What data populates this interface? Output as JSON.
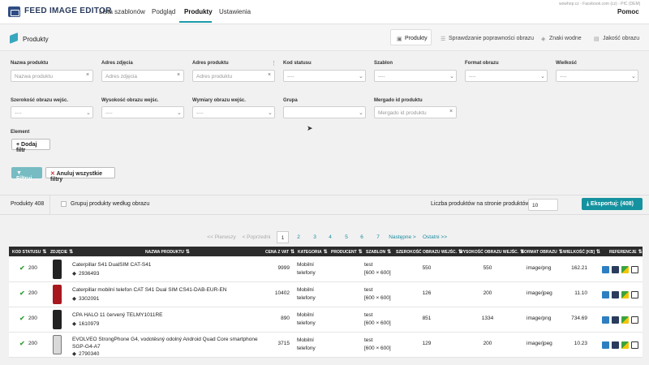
{
  "app": {
    "title": "FEED IMAGE EDITOR",
    "nav": [
      "Lista szablonów",
      "Podgląd",
      "Produkty",
      "Ustawienia"
    ],
    "active_nav": 2,
    "tiny_text": "wowhop.cz - Facebook.com (cz) - PIC (DEM)",
    "help": "Pomoc"
  },
  "sub": {
    "title": "Produkty",
    "tabs": [
      "Produkty",
      "Sprawdzanie poprawności obrazu",
      "Znaki wodne",
      "Jakość obrazu"
    ]
  },
  "filters": {
    "nazwa": {
      "label": "Nazwa produktu",
      "placeholder": "Nazwa produktu"
    },
    "adres_zdjecia": {
      "label": "Adres zdjęcia",
      "placeholder": "Adres zdjęcia"
    },
    "adres_produktu": {
      "label": "Adres produktu",
      "placeholder": "Adres produktu"
    },
    "kod_statusu": {
      "label": "Kod statusu",
      "placeholder": "----"
    },
    "szablon": {
      "label": "Szablon",
      "placeholder": "----"
    },
    "format": {
      "label": "Format obrazu",
      "placeholder": "----"
    },
    "wielkosc": {
      "label": "Wielkość",
      "placeholder": "----"
    },
    "szerokosc": {
      "label": "Szerokość obrazu wejśc.",
      "placeholder": "----"
    },
    "wysokosc": {
      "label": "Wysokość obrazu wejśc.",
      "placeholder": "----"
    },
    "wymiary": {
      "label": "Wymiary obrazu wejśc.",
      "placeholder": "----"
    },
    "grupa": {
      "label": "Grupa",
      "placeholder": ""
    },
    "mergado": {
      "label": "Mergado id produktu",
      "placeholder": "Mergado id produktu"
    },
    "element_label": "Element",
    "add_filter": "Dodaj filtr",
    "filter_btn": "Filtruj",
    "cancel_btn": "Anuluj wszystkie filtry"
  },
  "summary": {
    "count": "Produkty 408",
    "group_label": "Grupuj produkty według obrazu",
    "per_page_label": "Liczba produktów na stronie produktów:",
    "per_page": "10",
    "export": "Eksportuj: (408)"
  },
  "pagination": {
    "first": "<< Pierwszy",
    "prev": "< Poprzedni",
    "pages": [
      "1",
      "2",
      "3",
      "4",
      "5",
      "6",
      "7"
    ],
    "current": "1",
    "next": "Następne >",
    "last": "Ostatni >>"
  },
  "table": {
    "headers": [
      "KOD STATUSU",
      "ZDJĘCIE",
      "NAZWA PRODUKTU",
      "CENA Z VAT",
      "KATEGORIA",
      "PRODUCENT",
      "SZABLON",
      "SZEROKOŚĆ OBRAZU WEJŚC.",
      "WYSOKOŚĆ OBRAZU WEJŚC.",
      "FORMAT OBRAZU",
      "WIELKOŚĆ [KB]",
      "REFERENCJE"
    ],
    "rows": [
      {
        "status": "200",
        "name": "Caterpillar S41 DualSIM CAT-S41",
        "id": "2936493",
        "price": "9999",
        "cat1": "Mobilní",
        "cat2": "telefony",
        "tpl1": "test",
        "tpl2": "[600 × 600]",
        "w": "550",
        "h": "550",
        "fmt": "image/png",
        "size": "162.21",
        "img": "black"
      },
      {
        "status": "200",
        "name": "Caterpillar mobilní telefon CAT S41 Dual SIM CS41-DAB-EUR-EN",
        "id": "3302091",
        "price": "10402",
        "cat1": "Mobilní",
        "cat2": "telefony",
        "tpl1": "test",
        "tpl2": "[600 × 600]",
        "w": "126",
        "h": "200",
        "fmt": "image/jpeg",
        "size": "11.10",
        "img": "red"
      },
      {
        "status": "200",
        "name": "CPA HALO 11 červený TELMY1011RE",
        "id": "1610979",
        "price": "890",
        "cat1": "Mobilní",
        "cat2": "telefony",
        "tpl1": "test",
        "tpl2": "[600 × 600]",
        "w": "851",
        "h": "1334",
        "fmt": "image/png",
        "size": "734.69",
        "img": "black"
      },
      {
        "status": "200",
        "name": "EVOLVEO StrongPhone G4, vodotěsný odolný Android Quad Core smartphone",
        "name2": "SGP-G4-A7",
        "id": "2790340",
        "price": "3715",
        "cat1": "Mobilní",
        "cat2": "telefony",
        "tpl1": "test",
        "tpl2": "[600 × 600]",
        "w": "129",
        "h": "200",
        "fmt": "image/jpeg",
        "size": "10.23",
        "img": "white"
      }
    ]
  },
  "colors": {
    "accent": "#15929f",
    "status_ok": "#35a03a",
    "header_dark": "#2b2b2b"
  }
}
